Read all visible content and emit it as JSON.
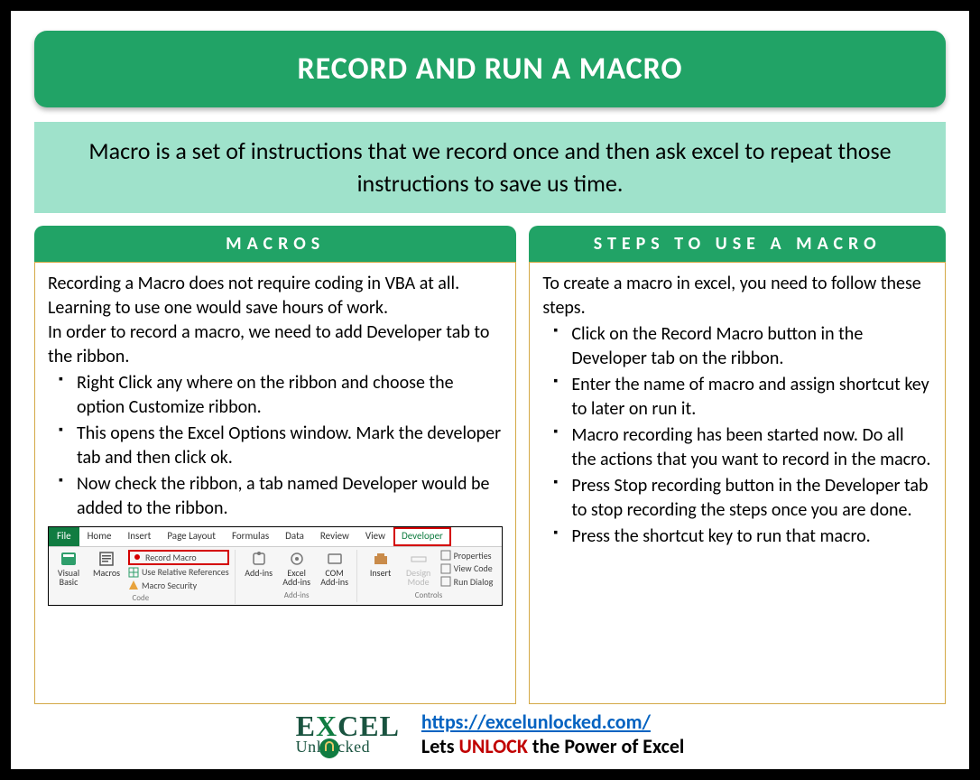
{
  "title": "RECORD AND RUN A MACRO",
  "intro": "Macro is a set of instructions that we record once and then ask excel to repeat those instructions to save us time.",
  "left": {
    "header": "MACROS",
    "para1": "Recording a Macro does not require coding in VBA at all. Learning to use one would save hours of work.",
    "para2": "In order to record a macro, we need to add Developer tab to the ribbon.",
    "bullets": [
      "Right Click any where on the ribbon and choose the option Customize ribbon.",
      "This opens the Excel Options window. Mark the developer tab and then click ok.",
      "Now check the ribbon, a tab named Developer would be added to the ribbon."
    ],
    "ribbon": {
      "tabs": [
        "File",
        "Home",
        "Insert",
        "Page Layout",
        "Formulas",
        "Data",
        "Review",
        "View",
        "Developer"
      ],
      "group_code": {
        "big1": "Visual Basic",
        "big2": "Macros",
        "s1": "Record Macro",
        "s2": "Use Relative References",
        "s3": "Macro Security",
        "label": "Code"
      },
      "group_addins": {
        "b1": "Add-ins",
        "b2": "Excel Add-ins",
        "b3": "COM Add-ins",
        "label": "Add-ins"
      },
      "group_controls": {
        "b1": "Insert",
        "b2": "Design Mode",
        "s1": "Properties",
        "s2": "View Code",
        "s3": "Run Dialog",
        "label": "Controls"
      }
    }
  },
  "right": {
    "header": "STEPS TO USE A MACRO",
    "para": "To create a macro in excel, you need to follow these steps.",
    "bullets": [
      "Click on the Record Macro button in the Developer tab on the ribbon.",
      "Enter the name of macro and assign shortcut key to later on run it.",
      "Macro recording has been started now. Do all the actions that  you want to record in the macro.",
      "Press Stop recording button in the Developer tab to stop recording the steps once you are done.",
      "Press the shortcut key to run that macro."
    ]
  },
  "footer": {
    "logo_big_pre": "E",
    "logo_big_x": "X",
    "logo_big_post": "CEL",
    "logo_sub_pre": "Unl",
    "logo_sub_post": "cked",
    "url": "https://excelunlocked.com/",
    "tag_pre": "Lets ",
    "tag_em": "UNLOCK",
    "tag_post": " the Power of Excel"
  }
}
